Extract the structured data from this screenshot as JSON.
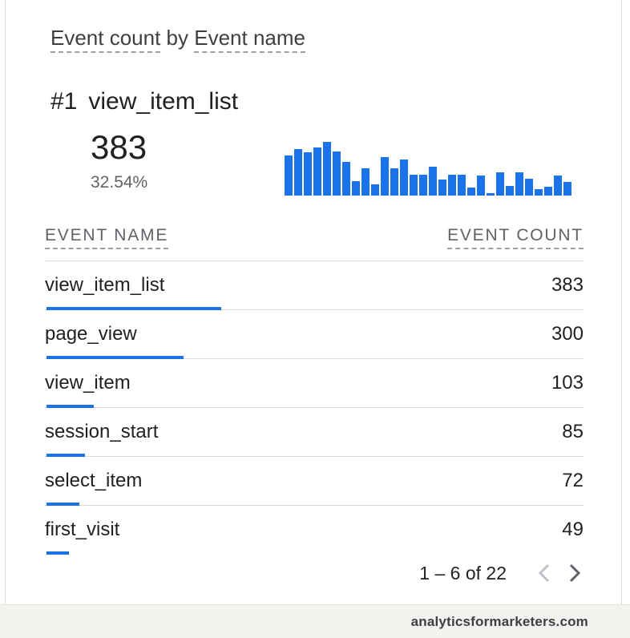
{
  "card": {
    "title_metric": "Event count",
    "title_by": "by",
    "title_dimension": "Event name"
  },
  "top": {
    "rank": "#1",
    "name": "view_item_list",
    "value": "383",
    "percent": "32.54%"
  },
  "sparkline": {
    "color": "#1a73e8",
    "values": [
      50,
      58,
      54,
      60,
      67,
      55,
      42,
      18,
      34,
      14,
      48,
      34,
      45,
      26,
      26,
      36,
      20,
      26,
      26,
      10,
      25,
      3,
      29,
      12,
      29,
      21,
      8,
      11,
      25,
      17
    ]
  },
  "table": {
    "col_name": "EVENT NAME",
    "col_count": "EVENT COUNT",
    "max_value": 383,
    "rows": [
      {
        "name": "view_item_list",
        "count": "383",
        "value": 383
      },
      {
        "name": "page_view",
        "count": "300",
        "value": 300
      },
      {
        "name": "view_item",
        "count": "103",
        "value": 103
      },
      {
        "name": "session_start",
        "count": "85",
        "value": 85
      },
      {
        "name": "select_item",
        "count": "72",
        "value": 72
      },
      {
        "name": "first_visit",
        "count": "49",
        "value": 49
      }
    ]
  },
  "pagination": {
    "text": "1 – 6 of 22"
  },
  "colors": {
    "accent": "#1a73e8",
    "disabled": "#bdc1c6",
    "active_arrow": "#5f6368"
  },
  "footer": {
    "text": "analyticsformarketers.com"
  }
}
